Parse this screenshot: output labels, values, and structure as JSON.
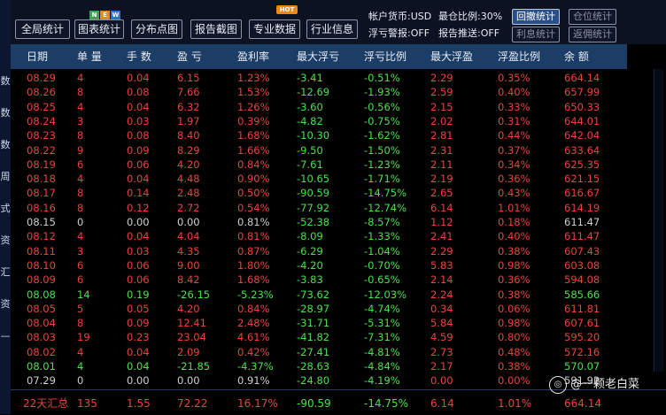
{
  "toolbar": {
    "buttons": [
      "全局统计",
      "图表统计",
      "分布点图",
      "报告截图",
      "专业数据",
      "行业信息"
    ],
    "new_badge": [
      "N",
      "E",
      "W"
    ],
    "hot_badge": "HOT",
    "account_currency": "帐户货币:USD",
    "max_ratio": "最仓比例:30%",
    "loss_alert": "浮亏警报:OFF",
    "report_push": "报告推送:OFF",
    "small_buttons": [
      "回撤统计",
      "仓位统计",
      "利息统计",
      "返佣统计"
    ]
  },
  "left_edge": [
    "数",
    "数",
    "数",
    "周",
    "式",
    "资",
    "汇",
    "资",
    "—"
  ],
  "columns": [
    "日期",
    "单 量",
    "手 数",
    "盈 亏",
    "盈利率",
    "最大浮亏",
    "浮亏比例",
    "最大浮盈",
    "浮盈比例",
    "余 额"
  ],
  "rows": [
    [
      "08.29",
      "4",
      "0.04",
      "6.15",
      "1.23%",
      "-3.41",
      "-0.51%",
      "2.29",
      "0.35%",
      "664.14",
      "r"
    ],
    [
      "08.26",
      "8",
      "0.08",
      "7.66",
      "1.53%",
      "-12.69",
      "-1.93%",
      "2.59",
      "0.40%",
      "657.99",
      "r"
    ],
    [
      "08.25",
      "4",
      "0.04",
      "6.32",
      "1.26%",
      "-3.60",
      "-0.56%",
      "2.15",
      "0.33%",
      "650.33",
      "r"
    ],
    [
      "08.24",
      "3",
      "0.03",
      "1.97",
      "0.39%",
      "-4.82",
      "-0.75%",
      "2.02",
      "0.31%",
      "644.01",
      "r"
    ],
    [
      "08.23",
      "8",
      "0.08",
      "8.40",
      "1.68%",
      "-10.30",
      "-1.62%",
      "2.81",
      "0.44%",
      "642.04",
      "r"
    ],
    [
      "08.22",
      "9",
      "0.09",
      "8.29",
      "1.66%",
      "-9.50",
      "-1.50%",
      "2.31",
      "0.37%",
      "633.64",
      "r"
    ],
    [
      "08.19",
      "6",
      "0.06",
      "4.20",
      "0.84%",
      "-7.61",
      "-1.23%",
      "2.11",
      "0.34%",
      "625.35",
      "r"
    ],
    [
      "08.18",
      "4",
      "0.04",
      "4.48",
      "0.90%",
      "-10.65",
      "-1.71%",
      "2.19",
      "0.36%",
      "621.15",
      "r"
    ],
    [
      "08.17",
      "8",
      "0.14",
      "2.48",
      "0.50%",
      "-90.59",
      "-14.75%",
      "2.65",
      "0.43%",
      "616.67",
      "r"
    ],
    [
      "08.16",
      "8",
      "0.12",
      "2.72",
      "0.54%",
      "-77.92",
      "-12.74%",
      "6.14",
      "1.01%",
      "614.19",
      "r"
    ],
    [
      "08.15",
      "0",
      "0.00",
      "0.00",
      "0.81%",
      "-52.38",
      "-8.57%",
      "1.12",
      "0.18%",
      "611.47",
      "w"
    ],
    [
      "08.12",
      "4",
      "0.04",
      "4.04",
      "0.81%",
      "-8.09",
      "-1.33%",
      "2.41",
      "0.40%",
      "611.47",
      "r"
    ],
    [
      "08.11",
      "3",
      "0.03",
      "4.35",
      "0.87%",
      "-6.29",
      "-1.04%",
      "2.29",
      "0.38%",
      "607.43",
      "r"
    ],
    [
      "08.10",
      "6",
      "0.06",
      "9.00",
      "1.80%",
      "-4.20",
      "-0.70%",
      "5.83",
      "0.98%",
      "603.08",
      "r"
    ],
    [
      "08.09",
      "6",
      "0.06",
      "8.42",
      "1.68%",
      "-3.83",
      "-0.65%",
      "2.14",
      "0.36%",
      "594.08",
      "r"
    ],
    [
      "08.08",
      "14",
      "0.19",
      "-26.15",
      "-5.23%",
      "-73.62",
      "-12.03%",
      "2.24",
      "0.38%",
      "585.66",
      "g"
    ],
    [
      "08.05",
      "5",
      "0.05",
      "4.20",
      "0.84%",
      "-28.97",
      "-4.74%",
      "0.34",
      "0.06%",
      "611.81",
      "r"
    ],
    [
      "08.04",
      "8",
      "0.09",
      "12.41",
      "2.48%",
      "-31.71",
      "-5.31%",
      "5.84",
      "0.98%",
      "607.61",
      "r"
    ],
    [
      "08.03",
      "19",
      "0.23",
      "23.04",
      "4.61%",
      "-41.82",
      "-7.31%",
      "4.59",
      "0.80%",
      "595.20",
      "r"
    ],
    [
      "08.02",
      "4",
      "0.04",
      "2.09",
      "0.42%",
      "-27.41",
      "-4.81%",
      "2.73",
      "0.48%",
      "572.16",
      "r"
    ],
    [
      "08.01",
      "4",
      "0.04",
      "-21.85",
      "-4.37%",
      "-28.63",
      "-4.84%",
      "2.17",
      "0.38%",
      "570.07",
      "g"
    ],
    [
      "07.29",
      "0",
      "0.00",
      "0.00",
      "0.91%",
      "-24.80",
      "-4.19%",
      "0.00",
      "0.00%",
      "591.92",
      "w"
    ]
  ],
  "summary": [
    "22天汇总",
    "135",
    "1.55",
    "72.22",
    "16.17%",
    "-90.59",
    "-14.75%",
    "6.14",
    "1.01%",
    "664.14"
  ],
  "watermark": "@一颗老白菜",
  "colors": {
    "red": "#e8453c",
    "green": "#4be04b",
    "white": "#cfcfcf",
    "header_bg": "#1b3d66",
    "toolbar_bg": "#0c1222"
  }
}
